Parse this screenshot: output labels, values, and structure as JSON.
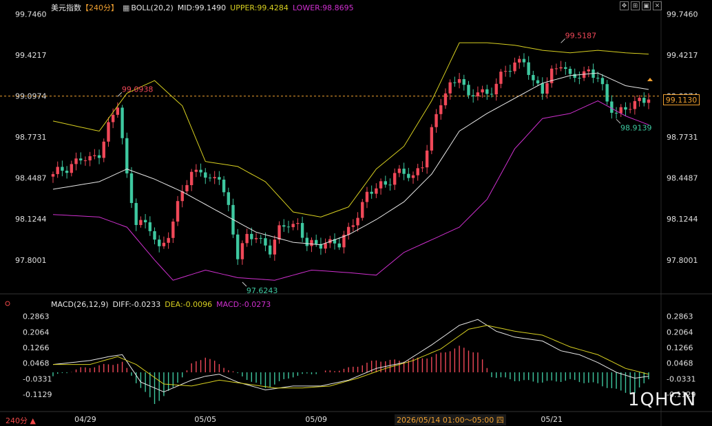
{
  "header": {
    "symbol": "美元指数",
    "period_tag": "【240分】",
    "boll_label": "BOLL(20,2)",
    "mid": "MID:99.1490",
    "upper": "UPPER:99.4284",
    "lower": "LOWER:98.8695"
  },
  "macd_header": {
    "label": "MACD(26,12,9)",
    "diff": "DIFF:-0.0233",
    "dea": "DEA:-0.0096",
    "macd": "MACD:-0.0273"
  },
  "current_price": "99.1130",
  "period_label": "240分 ▲",
  "crosshair_date": "2026/05/14 01:00～05:00 四",
  "watermark": "1QHCN",
  "toolbar_icons": [
    "move-icon",
    "zoom-icon",
    "restore-icon",
    "close-icon"
  ],
  "colors": {
    "up": "#f04858",
    "down": "#3ec8a0",
    "mid": "#e8e8e8",
    "upper": "#d8d020",
    "lower": "#d030d0",
    "accent": "#f0a030"
  },
  "chart_data": [
    {
      "type": "candlestick",
      "ylim": [
        97.57,
        99.76
      ],
      "y_ticks": [
        "99.7460",
        "99.4217",
        "99.0974",
        "98.7731",
        "98.4487",
        "98.1244",
        "97.8001"
      ],
      "y_tick_values": [
        99.746,
        99.4217,
        99.0974,
        98.7731,
        98.4487,
        98.1244,
        97.8001
      ],
      "x_ticks": [
        "04/29",
        "05/05",
        "05/09",
        "05/21"
      ],
      "x_tick_index": [
        7,
        33,
        57,
        108
      ],
      "reference_price": 99.0974,
      "annotations": [
        {
          "text": "99.0938",
          "index": 14,
          "price": 99.0938,
          "kind": "high"
        },
        {
          "text": "97.6243",
          "index": 41,
          "price": 97.6243,
          "kind": "low"
        },
        {
          "text": "99.5187",
          "index": 110,
          "price": 99.5187,
          "kind": "high"
        },
        {
          "text": "98.9139",
          "index": 122,
          "price": 98.9139,
          "kind": "low"
        }
      ],
      "close_anchors": [
        [
          0,
          98.46
        ],
        [
          2,
          98.52
        ],
        [
          4,
          98.56
        ],
        [
          6,
          98.6
        ],
        [
          8,
          98.58
        ],
        [
          10,
          98.66
        ],
        [
          12,
          98.86
        ],
        [
          14,
          99.02
        ],
        [
          16,
          98.46
        ],
        [
          18,
          98.12
        ],
        [
          21,
          98.04
        ],
        [
          23,
          97.88
        ],
        [
          26,
          98.1
        ],
        [
          28,
          98.34
        ],
        [
          30,
          98.48
        ],
        [
          32,
          98.54
        ],
        [
          34,
          98.4
        ],
        [
          36,
          98.46
        ],
        [
          38,
          98.22
        ],
        [
          40,
          97.84
        ],
        [
          42,
          97.96
        ],
        [
          44,
          98.0
        ],
        [
          47,
          97.88
        ],
        [
          49,
          98.02
        ],
        [
          51,
          98.1
        ],
        [
          53,
          98.08
        ],
        [
          55,
          97.92
        ],
        [
          57,
          97.9
        ],
        [
          59,
          97.96
        ],
        [
          62,
          97.92
        ],
        [
          64,
          98.02
        ],
        [
          66,
          98.18
        ],
        [
          68,
          98.32
        ],
        [
          70,
          98.36
        ],
        [
          72,
          98.4
        ],
        [
          74,
          98.5
        ],
        [
          76,
          98.48
        ],
        [
          78,
          98.44
        ],
        [
          80,
          98.58
        ],
        [
          82,
          98.82
        ],
        [
          84,
          99.04
        ],
        [
          86,
          99.18
        ],
        [
          88,
          99.28
        ],
        [
          90,
          99.06
        ],
        [
          92,
          99.14
        ],
        [
          94,
          99.12
        ],
        [
          96,
          99.2
        ],
        [
          98,
          99.28
        ],
        [
          100,
          99.36
        ],
        [
          102,
          99.4
        ],
        [
          104,
          99.18
        ],
        [
          106,
          99.14
        ],
        [
          108,
          99.3
        ],
        [
          110,
          99.36
        ],
        [
          112,
          99.22
        ],
        [
          114,
          99.28
        ],
        [
          116,
          99.3
        ],
        [
          118,
          99.24
        ],
        [
          120,
          99.04
        ],
        [
          122,
          98.98
        ],
        [
          124,
          99.0
        ],
        [
          126,
          99.02
        ],
        [
          129,
          99.11
        ]
      ],
      "series": [
        {
          "name": "MID",
          "values_at": [
            [
              0,
              98.36
            ],
            [
              10,
              98.42
            ],
            [
              16,
              98.52
            ],
            [
              22,
              98.44
            ],
            [
              28,
              98.34
            ],
            [
              36,
              98.18
            ],
            [
              44,
              98.02
            ],
            [
              52,
              97.94
            ],
            [
              58,
              97.92
            ],
            [
              64,
              98.0
            ],
            [
              70,
              98.12
            ],
            [
              76,
              98.26
            ],
            [
              82,
              98.48
            ],
            [
              88,
              98.82
            ],
            [
              94,
              98.96
            ],
            [
              100,
              99.08
            ],
            [
              106,
              99.2
            ],
            [
              112,
              99.26
            ],
            [
              118,
              99.28
            ],
            [
              124,
              99.18
            ],
            [
              129,
              99.15
            ]
          ]
        },
        {
          "name": "UPPER",
          "values_at": [
            [
              0,
              98.9
            ],
            [
              10,
              98.82
            ],
            [
              16,
              99.12
            ],
            [
              22,
              99.22
            ],
            [
              28,
              99.02
            ],
            [
              33,
              98.58
            ],
            [
              40,
              98.54
            ],
            [
              46,
              98.42
            ],
            [
              52,
              98.18
            ],
            [
              58,
              98.14
            ],
            [
              64,
              98.22
            ],
            [
              70,
              98.52
            ],
            [
              76,
              98.7
            ],
            [
              82,
              99.06
            ],
            [
              88,
              99.52
            ],
            [
              94,
              99.52
            ],
            [
              100,
              99.5
            ],
            [
              106,
              99.46
            ],
            [
              112,
              99.44
            ],
            [
              118,
              99.46
            ],
            [
              124,
              99.44
            ],
            [
              129,
              99.43
            ]
          ]
        },
        {
          "name": "LOWER",
          "values_at": [
            [
              0,
              98.16
            ],
            [
              10,
              98.14
            ],
            [
              16,
              98.06
            ],
            [
              22,
              97.8
            ],
            [
              26,
              97.64
            ],
            [
              33,
              97.72
            ],
            [
              40,
              97.66
            ],
            [
              48,
              97.64
            ],
            [
              56,
              97.72
            ],
            [
              64,
              97.7
            ],
            [
              70,
              97.68
            ],
            [
              76,
              97.86
            ],
            [
              82,
              97.96
            ],
            [
              88,
              98.06
            ],
            [
              94,
              98.28
            ],
            [
              100,
              98.68
            ],
            [
              106,
              98.92
            ],
            [
              112,
              98.96
            ],
            [
              118,
              99.06
            ],
            [
              124,
              98.94
            ],
            [
              129,
              98.87
            ]
          ]
        }
      ]
    },
    {
      "type": "macd",
      "ylim": [
        -0.19,
        0.32
      ],
      "y_ticks": [
        "0.2863",
        "0.2064",
        "0.1266",
        "0.0468",
        "-0.0331",
        "-0.1129"
      ],
      "y_tick_values": [
        0.2863,
        0.2064,
        0.1266,
        0.0468,
        -0.0331,
        -0.1129
      ],
      "series": [
        {
          "name": "DIFF",
          "values_at": [
            [
              0,
              0.04
            ],
            [
              8,
              0.06
            ],
            [
              12,
              0.08
            ],
            [
              15,
              0.09
            ],
            [
              19,
              -0.05
            ],
            [
              24,
              -0.1
            ],
            [
              30,
              -0.04
            ],
            [
              33,
              -0.02
            ],
            [
              36,
              -0.01
            ],
            [
              40,
              -0.05
            ],
            [
              46,
              -0.09
            ],
            [
              52,
              -0.07
            ],
            [
              58,
              -0.07
            ],
            [
              64,
              -0.04
            ],
            [
              70,
              0.02
            ],
            [
              76,
              0.05
            ],
            [
              82,
              0.14
            ],
            [
              88,
              0.24
            ],
            [
              92,
              0.27
            ],
            [
              96,
              0.21
            ],
            [
              100,
              0.18
            ],
            [
              106,
              0.16
            ],
            [
              110,
              0.11
            ],
            [
              114,
              0.09
            ],
            [
              118,
              0.05
            ],
            [
              122,
              0.0
            ],
            [
              126,
              -0.03
            ],
            [
              129,
              -0.02
            ]
          ]
        },
        {
          "name": "DEA",
          "values_at": [
            [
              0,
              0.04
            ],
            [
              8,
              0.04
            ],
            [
              14,
              0.08
            ],
            [
              18,
              0.04
            ],
            [
              24,
              -0.06
            ],
            [
              30,
              -0.07
            ],
            [
              36,
              -0.04
            ],
            [
              42,
              -0.06
            ],
            [
              48,
              -0.08
            ],
            [
              54,
              -0.08
            ],
            [
              60,
              -0.07
            ],
            [
              66,
              -0.03
            ],
            [
              72,
              0.02
            ],
            [
              78,
              0.06
            ],
            [
              84,
              0.12
            ],
            [
              90,
              0.22
            ],
            [
              94,
              0.24
            ],
            [
              100,
              0.21
            ],
            [
              106,
              0.19
            ],
            [
              112,
              0.13
            ],
            [
              118,
              0.09
            ],
            [
              124,
              0.02
            ],
            [
              129,
              -0.01
            ]
          ]
        },
        {
          "name": "MACD",
          "values_at": [
            [
              0,
              -0.02
            ],
            [
              6,
              0.02
            ],
            [
              12,
              0.04
            ],
            [
              15,
              0.05
            ],
            [
              18,
              -0.05
            ],
            [
              22,
              -0.16
            ],
            [
              26,
              -0.08
            ],
            [
              30,
              0.04
            ],
            [
              33,
              0.08
            ],
            [
              36,
              0.04
            ],
            [
              40,
              -0.01
            ],
            [
              46,
              -0.08
            ],
            [
              52,
              -0.02
            ],
            [
              58,
              0.0
            ],
            [
              64,
              0.02
            ],
            [
              70,
              0.06
            ],
            [
              76,
              0.06
            ],
            [
              82,
              0.08
            ],
            [
              88,
              0.13
            ],
            [
              92,
              0.1
            ],
            [
              95,
              -0.02
            ],
            [
              100,
              -0.04
            ],
            [
              106,
              -0.05
            ],
            [
              112,
              -0.04
            ],
            [
              118,
              -0.06
            ],
            [
              122,
              -0.09
            ],
            [
              126,
              -0.11
            ],
            [
              129,
              -0.03
            ]
          ]
        }
      ]
    }
  ]
}
